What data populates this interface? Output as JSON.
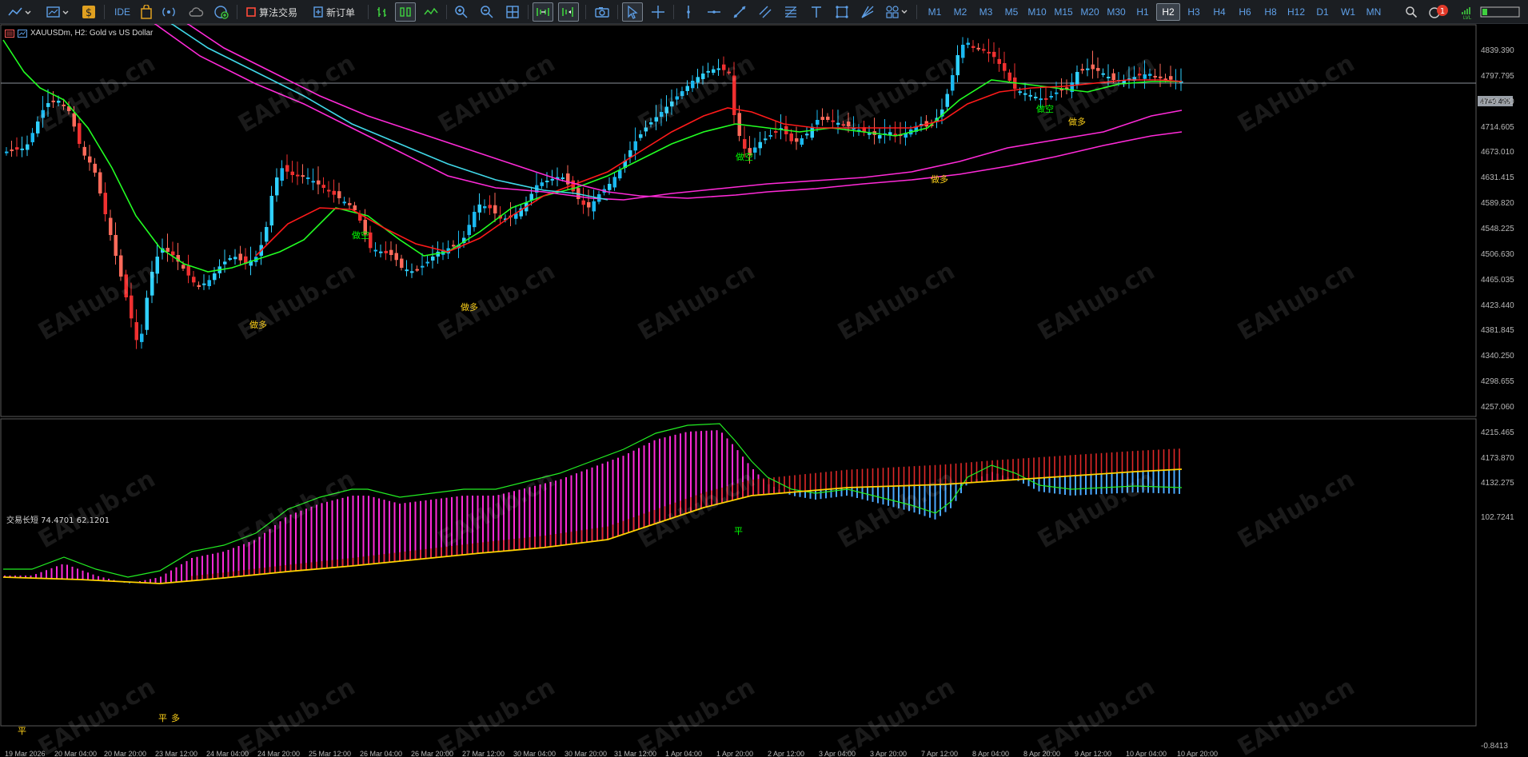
{
  "toolbar": {
    "algo_trading_label": "算法交易",
    "new_order_label": "新订单",
    "ide_label": "IDE",
    "timeframes": [
      "M1",
      "M2",
      "M3",
      "M5",
      "M10",
      "M15",
      "M20",
      "M30",
      "H1",
      "H2",
      "H3",
      "H4",
      "H6",
      "H8",
      "H12",
      "D1",
      "W1",
      "MN"
    ],
    "active_timeframe": "H2",
    "notification_count": "1"
  },
  "chart": {
    "title": "XAUUSDm, H2:  Gold vs US Dollar",
    "current_price": "4749.455",
    "price_ticks": [
      "4839.390",
      "4797.795",
      "4756.200",
      "4714.605",
      "4673.010",
      "4631.415",
      "4589.820",
      "4548.225",
      "4506.630",
      "4465.035",
      "4423.440",
      "4381.845",
      "4340.250",
      "4298.655",
      "4257.060",
      "4215.465",
      "4173.870",
      "4132.275"
    ],
    "signals": [
      {
        "text": "做多",
        "color": "#ffd21a"
      },
      {
        "text": "做空",
        "color": "#00ff00"
      },
      {
        "text": "做多",
        "color": "#ffd21a"
      },
      {
        "text": "做空",
        "color": "#00ff00"
      },
      {
        "text": "做多",
        "color": "#ffd21a"
      },
      {
        "text": "做空",
        "color": "#00ff00"
      },
      {
        "text": "做多",
        "color": "#ffd21a"
      }
    ]
  },
  "indicator": {
    "title": "交易长短 74.4701 62.1201",
    "axis_top": "102.7241",
    "axis_bottom": "-0.8413",
    "signals": [
      {
        "text": "平",
        "color": "#ffd21a"
      },
      {
        "text": "平",
        "color": "#ffd21a"
      },
      {
        "text": "多",
        "color": "#ffd21a"
      },
      {
        "text": "平",
        "color": "#00ff00"
      }
    ]
  },
  "time_axis": [
    "19 Mar 2026",
    "20 Mar 04:00",
    "20 Mar 20:00",
    "23 Mar 12:00",
    "24 Mar 04:00",
    "24 Mar 20:00",
    "25 Mar 12:00",
    "26 Mar 04:00",
    "26 Mar 20:00",
    "27 Mar 12:00",
    "30 Mar 04:00",
    "30 Mar 20:00",
    "31 Mar 12:00",
    "1 Apr 04:00",
    "1 Apr 20:00",
    "2 Apr 12:00",
    "3 Apr 04:00",
    "3 Apr 20:00",
    "7 Apr 12:00",
    "8 Apr 04:00",
    "8 Apr 20:00",
    "9 Apr 12:00",
    "10 Apr 04:00",
    "10 Apr 20:00"
  ],
  "watermark": "EAHub.cn",
  "colors": {
    "bull": "#1ab8f0",
    "bear": "#f03030",
    "bull_light": "#2fd0ff",
    "bear_light": "#ff6a5a",
    "ma_fast": "#ff1a1a",
    "ma_green": "#22ff22",
    "ma_cyan": "#40d8e8",
    "ma_magenta": "#ff2ad8",
    "osc_yellow": "#ffd200",
    "osc_green": "#22ee22"
  }
}
